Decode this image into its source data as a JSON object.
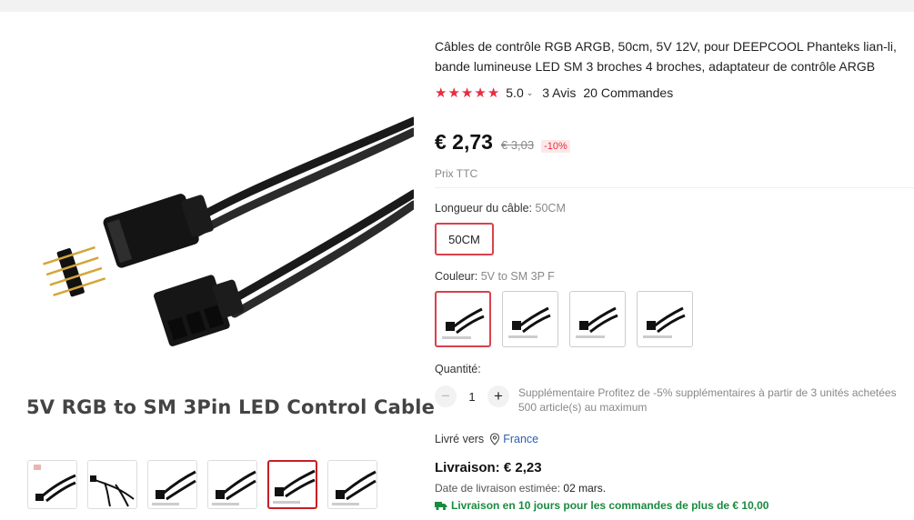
{
  "gallery": {
    "caption": "5V RGB to SM 3Pin LED Control Cable",
    "thumbnails": [
      {
        "name": "thumbnail-1",
        "selected": false
      },
      {
        "name": "thumbnail-2",
        "selected": false
      },
      {
        "name": "thumbnail-3",
        "selected": false
      },
      {
        "name": "thumbnail-4",
        "selected": false
      },
      {
        "name": "thumbnail-5",
        "selected": true
      },
      {
        "name": "thumbnail-6",
        "selected": false
      }
    ]
  },
  "product": {
    "title": "Câbles de contrôle RGB ARGB, 50cm, 5V 12V, pour DEEPCOOL Phanteks lian-li, bande lumineuse LED SM 3 broches 4 broches, adaptateur de contrôle ARGB",
    "rating": 5,
    "rating_label": "5.0",
    "reviews": "3 Avis",
    "orders": "20 Commandes",
    "price": "€ 2,73",
    "old_price": "€ 3,03",
    "discount": "-10%",
    "tax_note": "Prix TTC"
  },
  "options": {
    "length_label": "Longueur du câble:",
    "length_value": "50CM",
    "length_choice": "50CM",
    "color_label": "Couleur:",
    "color_value": "5V to SM 3P F",
    "color_choices_count": 4,
    "color_selected_index": 0
  },
  "quantity": {
    "label": "Quantité:",
    "value": "1",
    "minus": "−",
    "plus": "+",
    "promo": "Supplémentaire Profitez de -5% supplémentaires à partir de 3 unités achetées",
    "limit": "500 article(s) au maximum"
  },
  "shipping": {
    "ship_to_label": "Livré vers",
    "country": "France",
    "price": "Livraison: € 2,23",
    "estimate_label": "Date de livraison estimée:",
    "estimate_date": "02 mars.",
    "promo": "Livraison en 10 jours pour les commandes de plus de € 10,00"
  },
  "colors": {
    "star": "#e62e3f",
    "accent_border": "#d9414c",
    "promo_green": "#1a8a3f",
    "link_blue": "#2a5fb0"
  }
}
